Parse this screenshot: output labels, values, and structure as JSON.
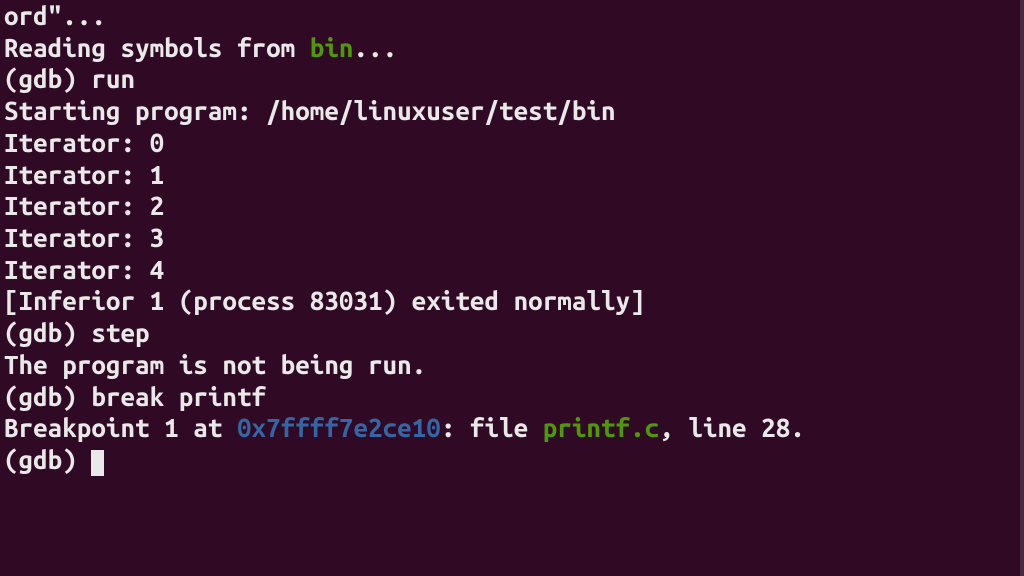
{
  "terminal": {
    "lines": {
      "l0": "ord\"...",
      "l1a": "Reading symbols from ",
      "l1b": "bin",
      "l1c": "...",
      "l2": "(gdb) run",
      "l3": "Starting program: /home/linuxuser/test/bin",
      "l4": "Iterator: 0",
      "l5": "Iterator: 1",
      "l6": "Iterator: 2",
      "l7": "Iterator: 3",
      "l8": "Iterator: 4",
      "l9": "[Inferior 1 (process 83031) exited normally]",
      "l10": "(gdb) step",
      "l11": "The program is not being run.",
      "l12": "(gdb) break printf",
      "l13a": "Breakpoint 1 at ",
      "l13b": "0x7ffff7e2ce10",
      "l13c": ": file ",
      "l13d": "printf.c",
      "l13e": ", line 28.",
      "l14": "(gdb) "
    }
  },
  "colors": {
    "background": "#300a24",
    "foreground": "#e9e9e9",
    "green": "#4e9a06",
    "blue": "#3465a4"
  }
}
